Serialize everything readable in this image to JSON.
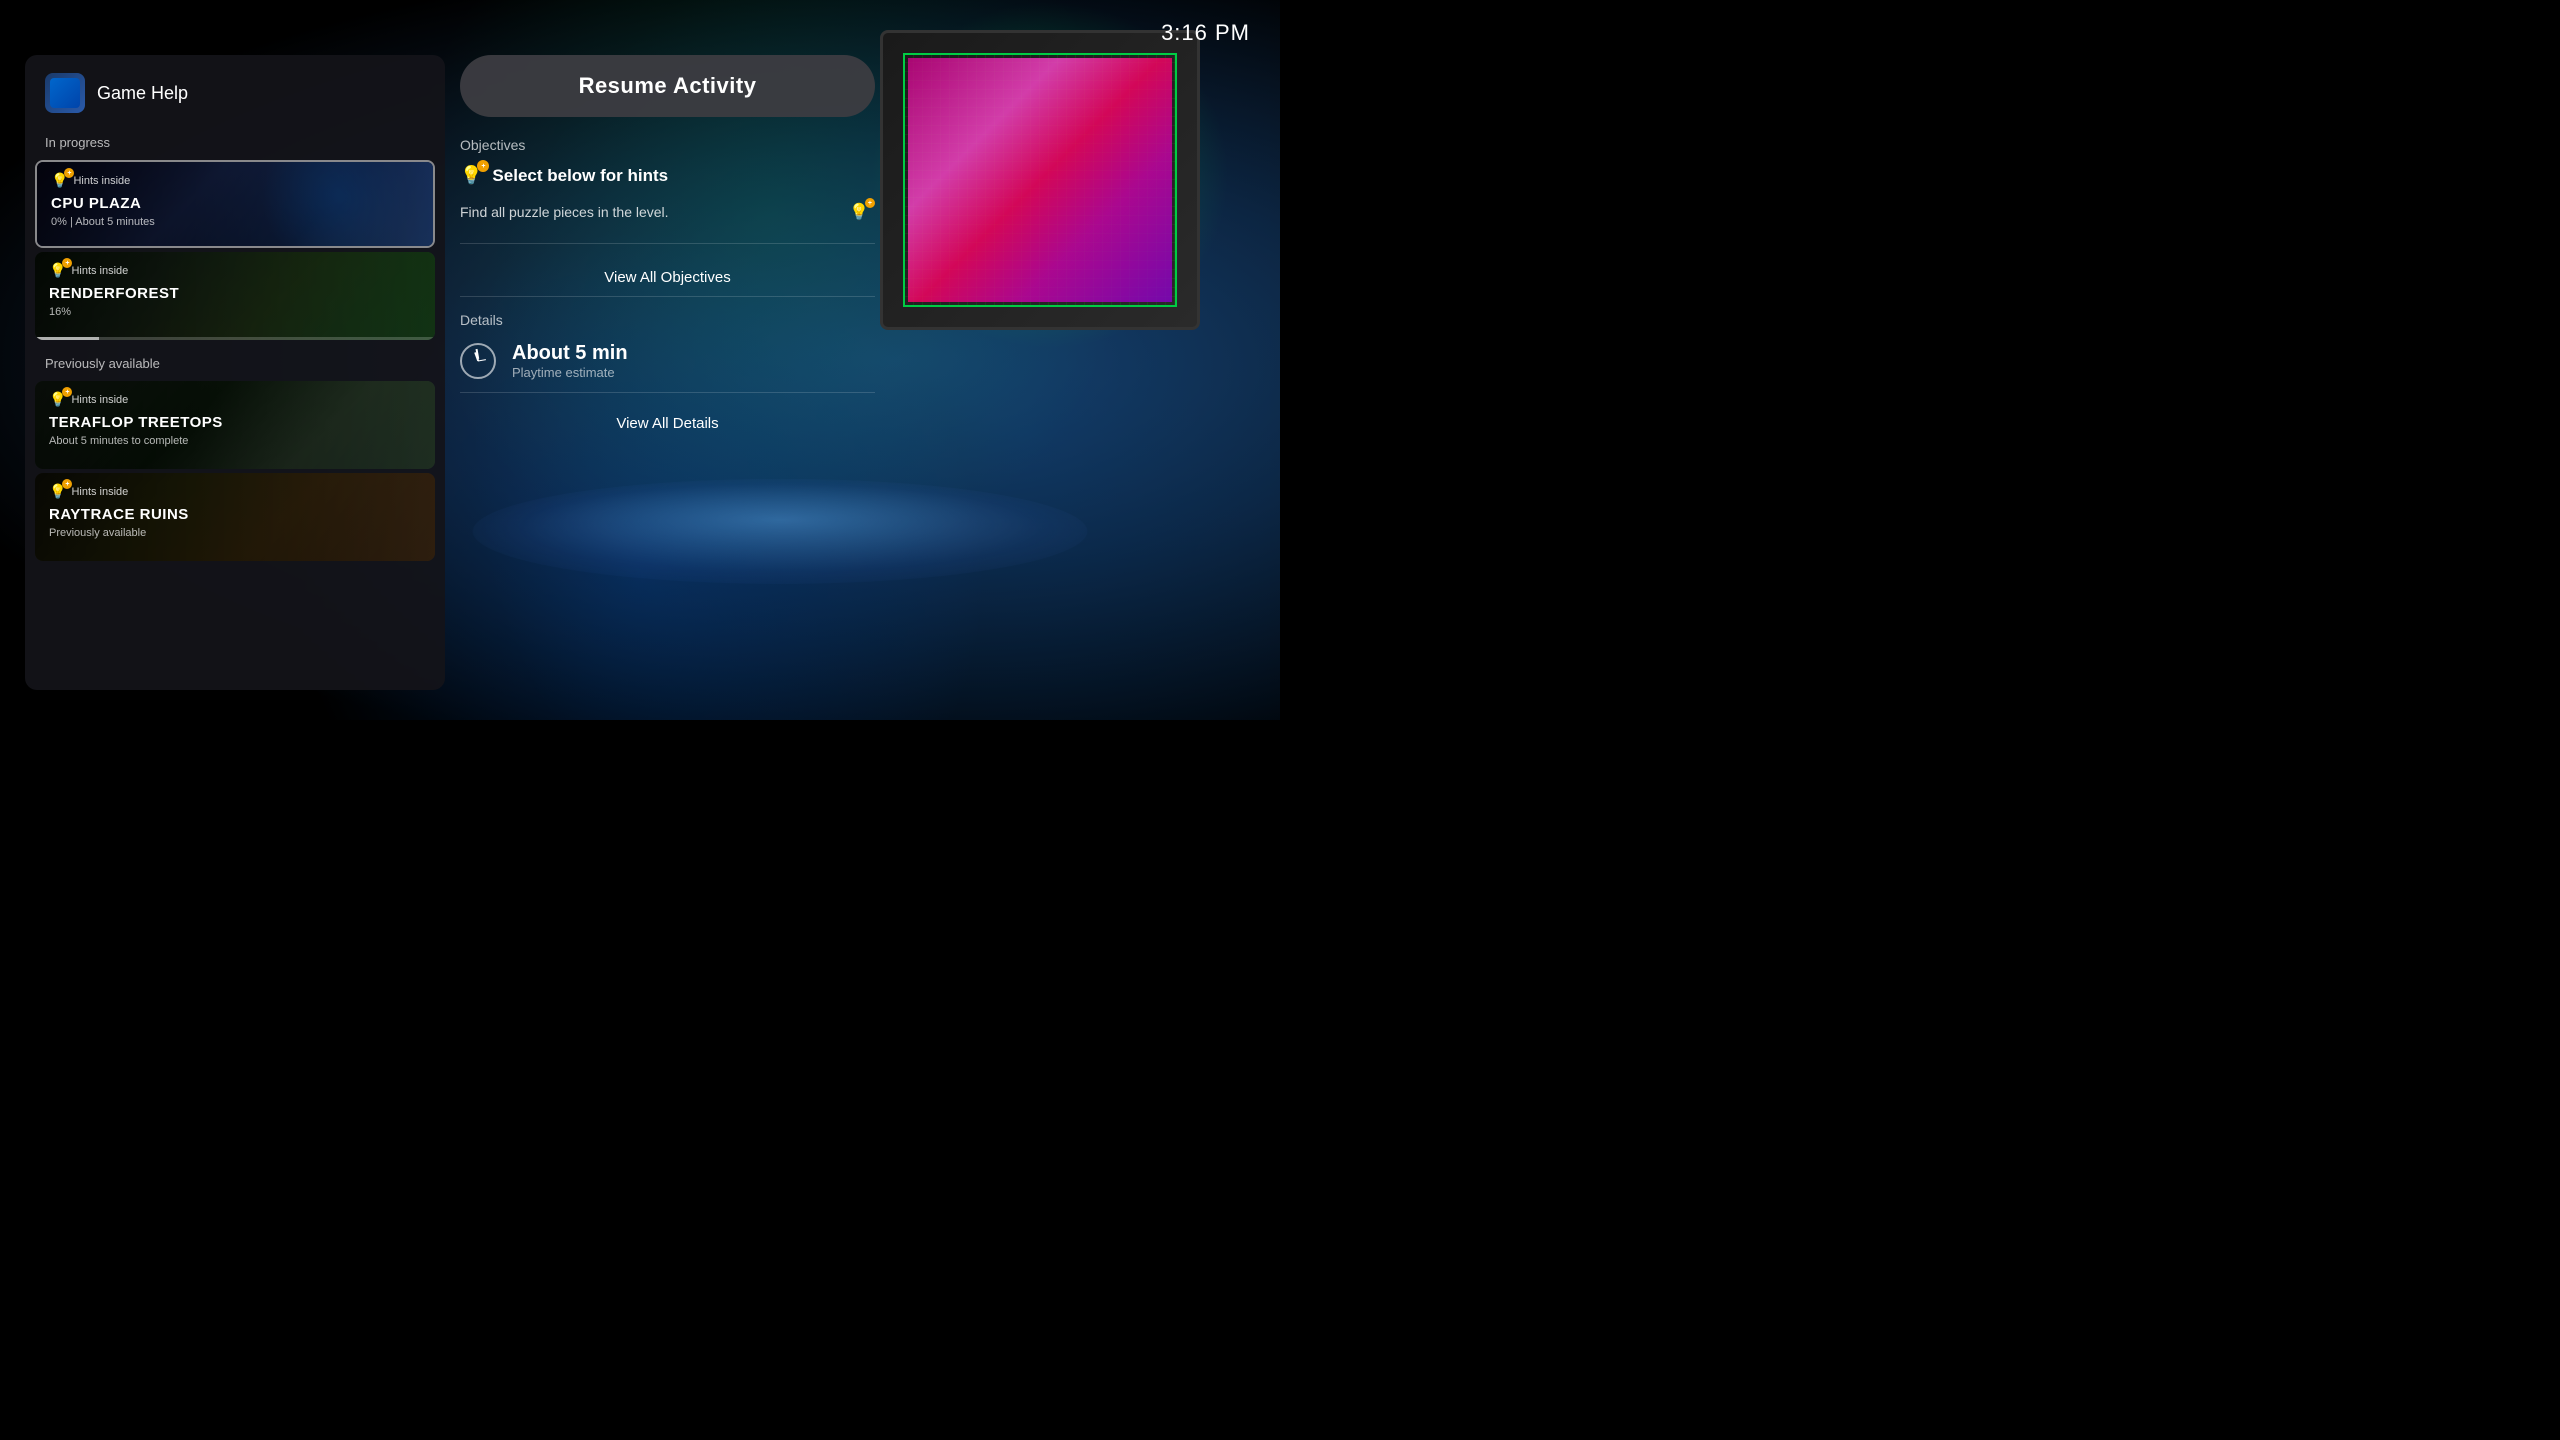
{
  "time": "3:16 PM",
  "header": {
    "title": "Game Help"
  },
  "left_panel": {
    "in_progress_label": "In progress",
    "previously_available_label": "Previously available",
    "in_progress_cards": [
      {
        "id": "cpu-plaza",
        "hints_label": "Hints inside",
        "name": "CPU PLAZA",
        "sub": "0%  |  About 5 minutes",
        "progress": 0,
        "active": true
      },
      {
        "id": "renderforest",
        "hints_label": "Hints inside",
        "name": "RENDERFOREST",
        "sub": "16%",
        "progress": 16,
        "active": false
      }
    ],
    "prev_cards": [
      {
        "id": "teraflop-treetops",
        "hints_label": "Hints inside",
        "name": "TERAFLOP TREETOPS",
        "sub": "About 5 minutes to complete",
        "active": false
      },
      {
        "id": "raytrace-ruins",
        "hints_label": "Hints inside",
        "name": "RAYTRACE RUINS",
        "sub": "Previously available",
        "active": false
      }
    ]
  },
  "right_panel": {
    "resume_button_label": "Resume Activity",
    "objectives": {
      "section_title": "Objectives",
      "primary_label": "Select below for hints",
      "description": "Find all puzzle pieces in the level.",
      "view_all_label": "View All Objectives"
    },
    "details": {
      "section_title": "Details",
      "time_main": "About 5 min",
      "time_sub": "Playtime estimate",
      "view_all_label": "View All Details"
    }
  }
}
